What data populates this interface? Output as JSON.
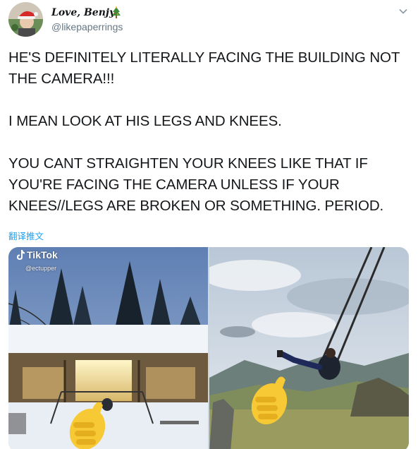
{
  "author": {
    "display_name": "Love, Benjy",
    "handle": "@likepaperrings",
    "avatar": "avatar-santa-hat",
    "name_emoji": "christmas-tree-icon"
  },
  "tweet": {
    "lines": [
      "HE'S DEFINITELY LITERALLY FACING THE BUILDING NOT",
      "THE CAMERA!!!",
      "I MEAN LOOK AT HIS LEGS AND KNEES.",
      "YOU CANT STRAIGHTEN YOUR KNEES LIKE THAT IF",
      "YOU'RE FACING THE CAMERA UNLESS IF YOUR",
      "KNEES//LEGS ARE BROKEN OR SOMETHING. PERIOD."
    ],
    "translate_label": "翻译推文"
  },
  "media": {
    "left": {
      "watermark_app": "TikTok",
      "watermark_user": "@ectupper",
      "description_icons": [
        "tiktok-icon",
        "thumbs-up-icon"
      ]
    },
    "right": {
      "description_icons": [
        "thumbs-up-icon"
      ]
    }
  },
  "colors": {
    "text": "#14171a",
    "secondary": "#657786",
    "link": "#1da1f2"
  }
}
